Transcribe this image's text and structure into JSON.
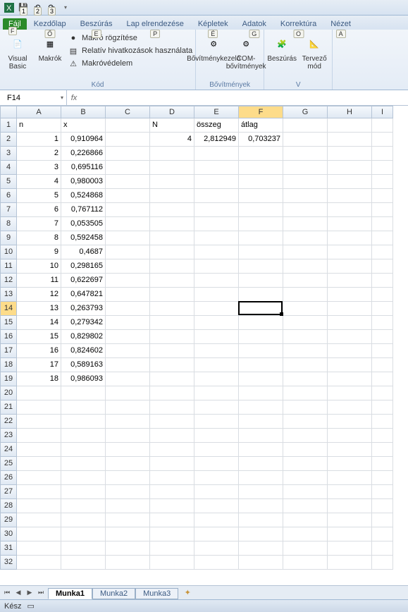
{
  "qat": {
    "items": [
      "excel-icon",
      "save-icon",
      "undo-icon",
      "redo-icon",
      "dropdown-icon"
    ],
    "badges": [
      "1",
      "2",
      "3"
    ]
  },
  "file_tab": {
    "label": "Fájl",
    "key": "F"
  },
  "tabs": [
    {
      "label": "Kezdőlap",
      "key": "Ő"
    },
    {
      "label": "Beszúrás",
      "key": "E"
    },
    {
      "label": "Lap elrendezése",
      "key": "P"
    },
    {
      "label": "Képletek",
      "key": "É"
    },
    {
      "label": "Adatok",
      "key": "G"
    },
    {
      "label": "Korrektúra",
      "key": "O"
    },
    {
      "label": "Nézet",
      "key": "A"
    }
  ],
  "ribbon": {
    "groups": [
      {
        "label": "Kód",
        "big": [
          {
            "name": "visual-basic-button",
            "icon": "📄",
            "label": "Visual Basic"
          },
          {
            "name": "macros-button",
            "icon": "▦",
            "label": "Makrók"
          }
        ],
        "small": [
          {
            "name": "record-macro",
            "icon": "●",
            "label": "Makró rögzítése"
          },
          {
            "name": "relative-refs",
            "icon": "▤",
            "label": "Relatív hivatkozások használata"
          },
          {
            "name": "macro-security",
            "icon": "⚠",
            "label": "Makróvédelem"
          }
        ]
      },
      {
        "label": "Bővítmények",
        "big": [
          {
            "name": "addins-button",
            "icon": "⚙",
            "label": "Bővítménykezelő"
          },
          {
            "name": "com-addins-button",
            "icon": "⚙",
            "label": "COM-bővítmények"
          }
        ],
        "small": []
      },
      {
        "label": "V",
        "big": [
          {
            "name": "insert-controls-button",
            "icon": "🧩",
            "label": "Beszúrás"
          },
          {
            "name": "design-mode-button",
            "icon": "📐",
            "label": "Tervező mód"
          }
        ],
        "small": []
      }
    ]
  },
  "namebox": "F14",
  "formula": "",
  "columns": [
    "A",
    "B",
    "C",
    "D",
    "E",
    "F",
    "G",
    "H",
    "I"
  ],
  "active_col_index": 5,
  "rows_count": 32,
  "active_row": 14,
  "active_cell": {
    "col": "F",
    "row": 14
  },
  "cells": {
    "A1": {
      "v": "n",
      "a": "l"
    },
    "B1": {
      "v": "x",
      "a": "l"
    },
    "D1": {
      "v": "N",
      "a": "l"
    },
    "E1": {
      "v": "összeg",
      "a": "l"
    },
    "F1": {
      "v": "átlag",
      "a": "l"
    },
    "A2": {
      "v": "1",
      "a": "r"
    },
    "B2": {
      "v": "0,910964",
      "a": "r"
    },
    "D2": {
      "v": "4",
      "a": "r"
    },
    "E2": {
      "v": "2,812949",
      "a": "r"
    },
    "F2": {
      "v": "0,703237",
      "a": "r"
    },
    "A3": {
      "v": "2",
      "a": "r"
    },
    "B3": {
      "v": "0,226866",
      "a": "r"
    },
    "A4": {
      "v": "3",
      "a": "r"
    },
    "B4": {
      "v": "0,695116",
      "a": "r"
    },
    "A5": {
      "v": "4",
      "a": "r"
    },
    "B5": {
      "v": "0,980003",
      "a": "r"
    },
    "A6": {
      "v": "5",
      "a": "r"
    },
    "B6": {
      "v": "0,524868",
      "a": "r"
    },
    "A7": {
      "v": "6",
      "a": "r"
    },
    "B7": {
      "v": "0,767112",
      "a": "r"
    },
    "A8": {
      "v": "7",
      "a": "r"
    },
    "B8": {
      "v": "0,053505",
      "a": "r"
    },
    "A9": {
      "v": "8",
      "a": "r"
    },
    "B9": {
      "v": "0,592458",
      "a": "r"
    },
    "A10": {
      "v": "9",
      "a": "r"
    },
    "B10": {
      "v": "0,4687",
      "a": "r"
    },
    "A11": {
      "v": "10",
      "a": "r"
    },
    "B11": {
      "v": "0,298165",
      "a": "r"
    },
    "A12": {
      "v": "11",
      "a": "r"
    },
    "B12": {
      "v": "0,622697",
      "a": "r"
    },
    "A13": {
      "v": "12",
      "a": "r"
    },
    "B13": {
      "v": "0,647821",
      "a": "r"
    },
    "A14": {
      "v": "13",
      "a": "r"
    },
    "B14": {
      "v": "0,263793",
      "a": "r"
    },
    "A15": {
      "v": "14",
      "a": "r"
    },
    "B15": {
      "v": "0,279342",
      "a": "r"
    },
    "A16": {
      "v": "15",
      "a": "r"
    },
    "B16": {
      "v": "0,829802",
      "a": "r"
    },
    "A17": {
      "v": "16",
      "a": "r"
    },
    "B17": {
      "v": "0,824602",
      "a": "r"
    },
    "A18": {
      "v": "17",
      "a": "r"
    },
    "B18": {
      "v": "0,589163",
      "a": "r"
    },
    "A19": {
      "v": "18",
      "a": "r"
    },
    "B19": {
      "v": "0,986093",
      "a": "r"
    }
  },
  "sheets": {
    "nav": [
      "⏮",
      "◀",
      "▶",
      "⏭"
    ],
    "tabs": [
      "Munka1",
      "Munka2",
      "Munka3"
    ],
    "active": 0
  },
  "status": {
    "text": "Kész",
    "icon": "▭"
  }
}
